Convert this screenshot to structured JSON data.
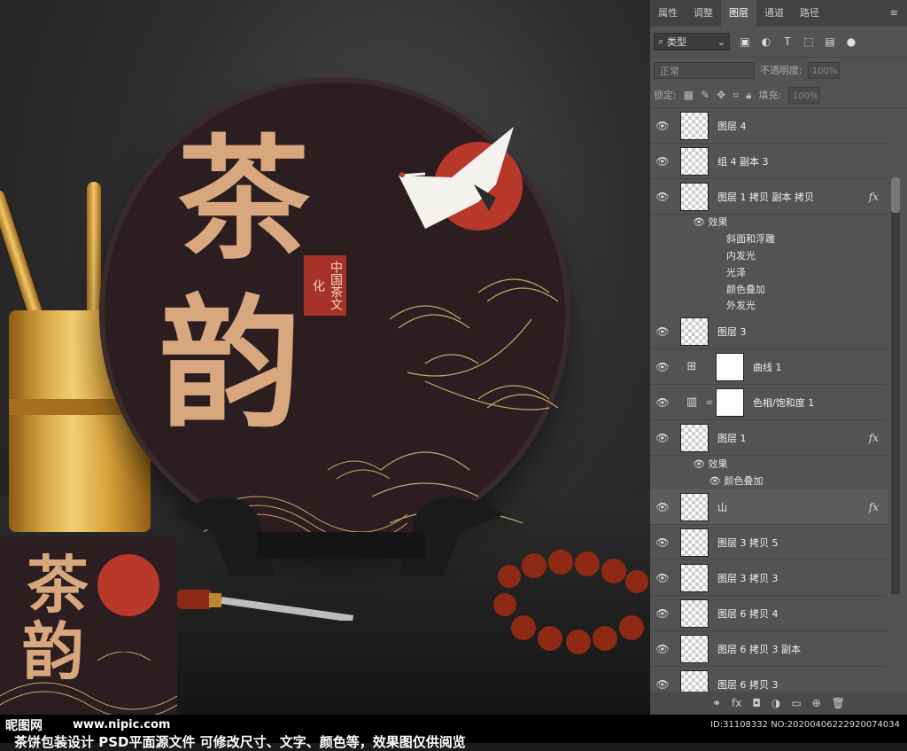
{
  "panel": {
    "tabs": [
      "属性",
      "调整",
      "图层",
      "通道",
      "路径"
    ],
    "active_tab": "图层",
    "filter_label": "类型",
    "blend_mode": "正常",
    "opacity_label": "不透明度:",
    "opacity_value": "100%",
    "lock_label": "锁定:",
    "fill_label": "填充:",
    "fill_value": "100%",
    "layers": [
      {
        "name": "图层 4",
        "kind": "pixel",
        "fx": false
      },
      {
        "name": "组 4 副本 3",
        "kind": "pixel",
        "fx": false
      },
      {
        "name": "图层 1 拷贝 副本 拷贝",
        "kind": "pixel",
        "fx": true
      },
      {
        "name": "图层 3",
        "kind": "pixel",
        "fx": false
      },
      {
        "name": "曲线 1",
        "kind": "curves",
        "fx": false
      },
      {
        "name": "色相/饱和度 1",
        "kind": "hue",
        "fx": false
      },
      {
        "name": "图层 1",
        "kind": "pixel",
        "fx": true
      },
      {
        "name": "山",
        "kind": "pixel",
        "fx": true
      },
      {
        "name": "图层 3 拷贝 5",
        "kind": "pixel",
        "fx": false
      },
      {
        "name": "图层 3 拷贝 3",
        "kind": "pixel",
        "fx": false
      },
      {
        "name": "图层 6 拷贝 4",
        "kind": "pixel",
        "fx": false
      },
      {
        "name": "图层 6 拷贝 3 副本",
        "kind": "pixel",
        "fx": false
      },
      {
        "name": "图层 6 拷贝 3",
        "kind": "pixel",
        "fx": false
      }
    ],
    "effects_a": {
      "title": "效果",
      "items": [
        "斜面和浮雕",
        "内发光",
        "光泽",
        "颜色叠加",
        "外发光"
      ]
    },
    "effects_b": {
      "title": "效果",
      "items": [
        "颜色叠加"
      ]
    },
    "fx_label": "fx"
  },
  "artwork": {
    "char1": "茶",
    "char2": "韵",
    "seal": "中国茶文化"
  },
  "watermark": {
    "logo": "昵图网",
    "url": "www.nipic.com",
    "id": "ID:31108332 NO:20200406222920074034",
    "description": "茶饼包装设计 PSD平面源文件 可修改尺寸、文字、颜色等，效果图仅供阅览"
  }
}
